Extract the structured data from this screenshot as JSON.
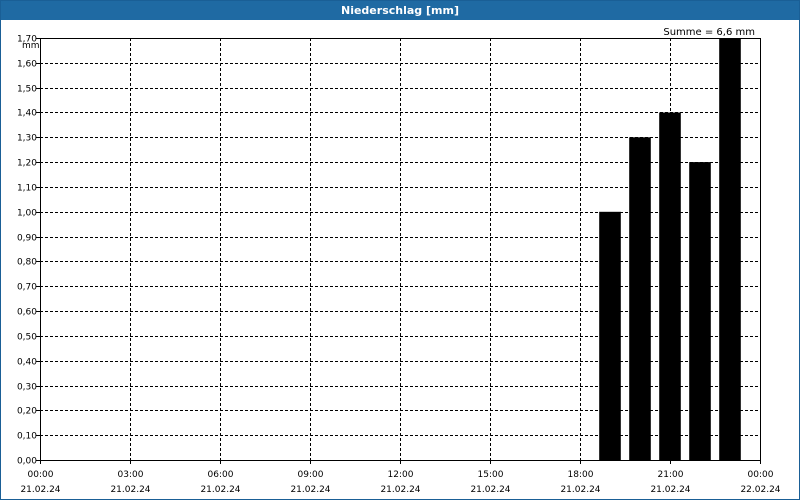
{
  "window": {
    "title": "Niederschlag [mm]"
  },
  "summary": "Summe = 6,6 mm",
  "colors": {
    "title_bar": "#1f6aa3",
    "bar_fill": "#000000",
    "grid": "#000000"
  },
  "chart_data": {
    "type": "bar",
    "title": "Niederschlag [mm]",
    "ylabel": "mm",
    "xlabel": "",
    "ylim": [
      0,
      1.7
    ],
    "y_ticks": [
      "0,00",
      "0,10",
      "0,20",
      "0,30",
      "0,40",
      "0,50",
      "0,60",
      "0,70",
      "0,80",
      "0,90",
      "1,00",
      "1,10",
      "1,20",
      "1,30",
      "1,40",
      "1,50",
      "1,60",
      "1,70"
    ],
    "x_range_hours": [
      0,
      24
    ],
    "x_ticks": [
      {
        "time": "00:00",
        "date": "21.02.24"
      },
      {
        "time": "03:00",
        "date": "21.02.24"
      },
      {
        "time": "06:00",
        "date": "21.02.24"
      },
      {
        "time": "09:00",
        "date": "21.02.24"
      },
      {
        "time": "12:00",
        "date": "21.02.24"
      },
      {
        "time": "15:00",
        "date": "21.02.24"
      },
      {
        "time": "18:00",
        "date": "21.02.24"
      },
      {
        "time": "21:00",
        "date": "21.02.24"
      },
      {
        "time": "00:00",
        "date": "22.02.24"
      }
    ],
    "bars": [
      {
        "hour": 19,
        "value": 1.0
      },
      {
        "hour": 20,
        "value": 1.3
      },
      {
        "hour": 21,
        "value": 1.4
      },
      {
        "hour": 22,
        "value": 1.2
      },
      {
        "hour": 23,
        "value": 1.7
      }
    ],
    "grid": true,
    "legend": "none"
  }
}
